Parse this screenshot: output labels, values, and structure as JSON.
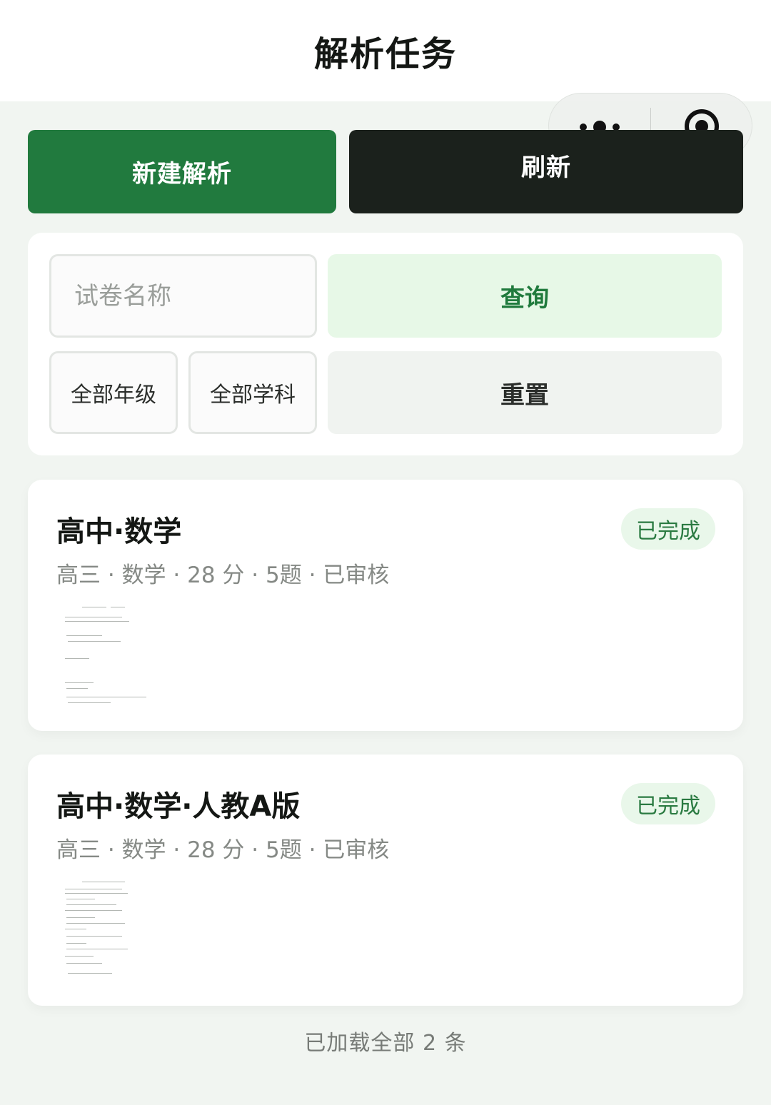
{
  "header": {
    "title": "解析任务"
  },
  "capsule": {
    "more_icon": "ellipsis-icon",
    "close_icon": "target-circle-icon"
  },
  "actions": {
    "new_label": "新建解析",
    "refresh_label": "刷新"
  },
  "filters": {
    "search_placeholder": "试卷名称",
    "grade_label": "全部年级",
    "subject_label": "全部学科",
    "query_label": "查询",
    "reset_label": "重置"
  },
  "tasks": [
    {
      "title": "高中·数学",
      "meta": "高三 · 数学 · 28 分 · 5题 · 已审核",
      "status": "已完成"
    },
    {
      "title": "高中·数学·人教A版",
      "meta": "高三 · 数学 · 28 分 · 5题 · 已审核",
      "status": "已完成"
    }
  ],
  "footer": {
    "loaded_text": "已加载全部 2 条"
  },
  "colors": {
    "primary_green": "#217a3e",
    "dark_button": "#1b211c",
    "query_bg": "#e7f8e7",
    "badge_bg": "#e9f7ea",
    "page_bg": "#f1f5f1"
  }
}
